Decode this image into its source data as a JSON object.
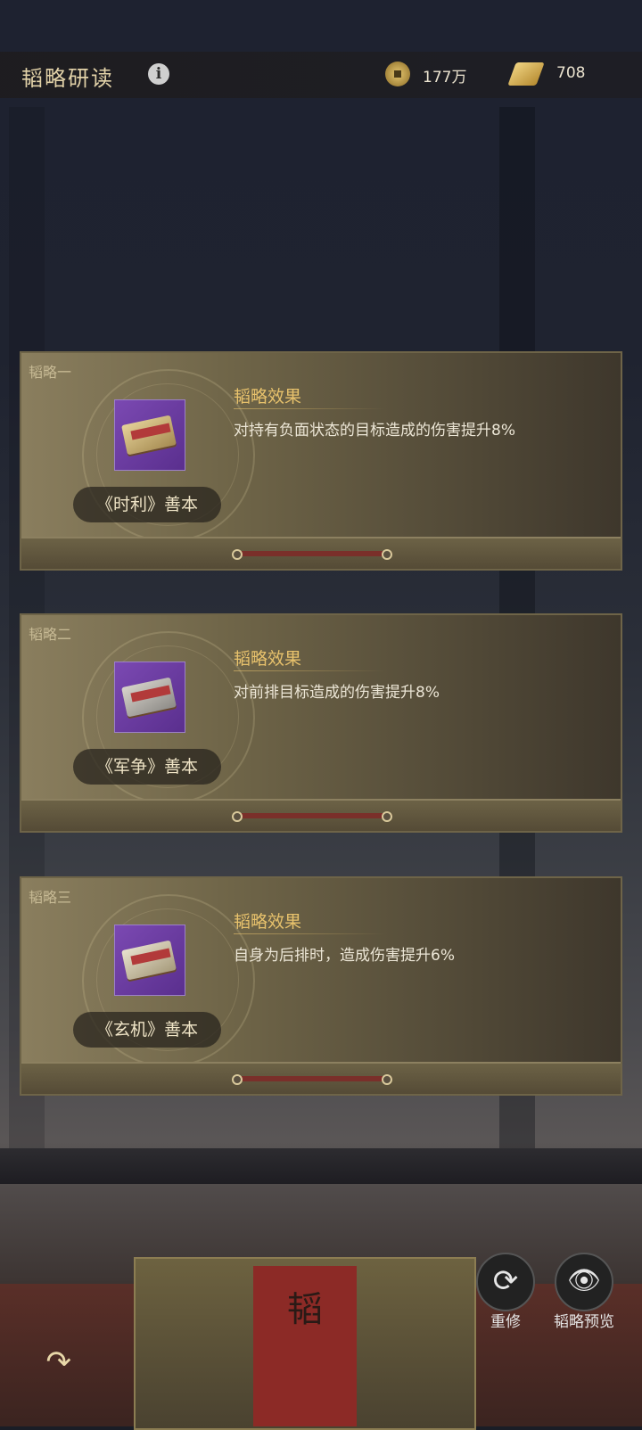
{
  "header": {
    "title": "韬略研读",
    "info_icon": "i",
    "coins_value": "177万",
    "scrolls_value": "708"
  },
  "cards": [
    {
      "slot": "韬略一",
      "name": "《时利》善本",
      "effect_title": "韬略效果",
      "effect": "对持有负面状态的目标造成的伤害提升8%"
    },
    {
      "slot": "韬略二",
      "name": "《军争》善本",
      "effect_title": "韬略效果",
      "effect": "对前排目标造成的伤害提升8%"
    },
    {
      "slot": "韬略三",
      "name": "《玄机》善本",
      "effect_title": "韬略效果",
      "effect": "自身为后排时，造成伤害提升6%"
    }
  ],
  "actions": {
    "reforge_label": "重修",
    "preview_label": "韬略预览"
  },
  "colors": {
    "gold_text": "#e8c26c",
    "item_purple": "#7b49b2"
  }
}
